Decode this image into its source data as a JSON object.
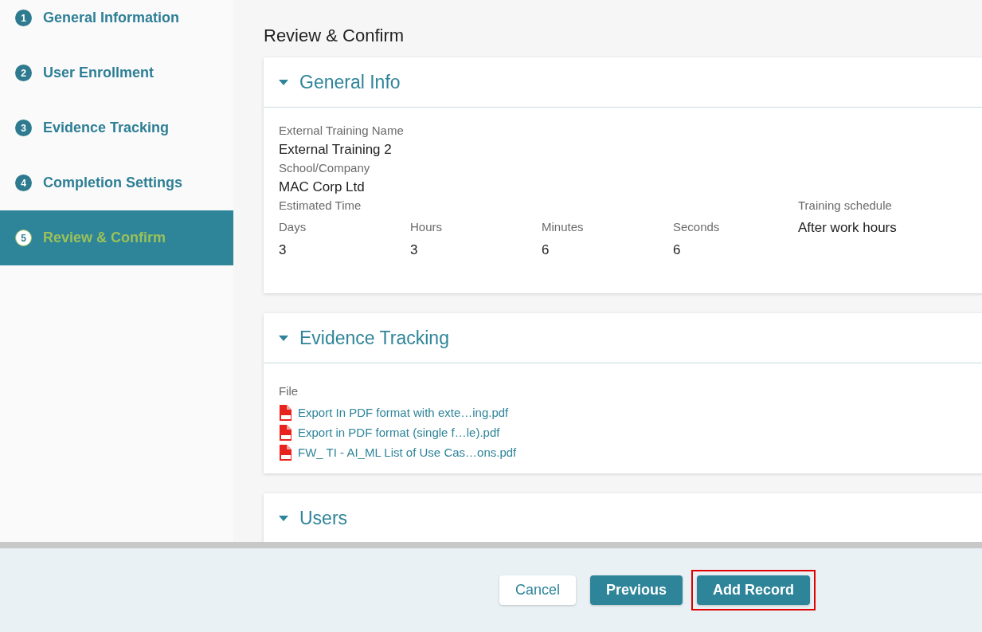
{
  "sidebar": {
    "steps": [
      {
        "number": "1",
        "label": "General Information",
        "selected": false
      },
      {
        "number": "2",
        "label": "User Enrollment",
        "selected": false
      },
      {
        "number": "3",
        "label": "Evidence Tracking",
        "selected": false
      },
      {
        "number": "4",
        "label": "Completion Settings",
        "selected": false
      },
      {
        "number": "5",
        "label": "Review & Confirm",
        "selected": true
      }
    ]
  },
  "page_title": "Review & Confirm",
  "sections": [
    {
      "kind": "general",
      "title": "General Info",
      "expanded": true,
      "fields": [
        {
          "label": "External Training Name",
          "value": "External Training 2"
        },
        {
          "label": "School/Company",
          "value": "MAC Corp Ltd"
        }
      ],
      "estimated_time": {
        "label": "Estimated Time",
        "parts": [
          {
            "label": "Days",
            "value": "3"
          },
          {
            "label": "Hours",
            "value": "3"
          },
          {
            "label": "Minutes",
            "value": "6"
          },
          {
            "label": "Seconds",
            "value": "6"
          }
        ]
      },
      "schedule": {
        "label": "Training schedule",
        "value": "After work hours"
      }
    },
    {
      "kind": "files",
      "title": "Evidence Tracking",
      "expanded": true,
      "label": "File",
      "files": [
        "Export In PDF format with exte…ing.pdf",
        "Export in PDF format (single f…le).pdf",
        "FW_ TI - AI_ML List of Use Cas…ons.pdf"
      ]
    },
    {
      "kind": "users",
      "title": "Users",
      "expanded": true
    }
  ],
  "footer": {
    "buttons": [
      {
        "label": "Cancel",
        "kind": "secondary",
        "highlighted": false
      },
      {
        "label": "Previous",
        "kind": "primary",
        "highlighted": false
      },
      {
        "label": "Add Record",
        "kind": "primary",
        "highlighted": true
      }
    ]
  }
}
